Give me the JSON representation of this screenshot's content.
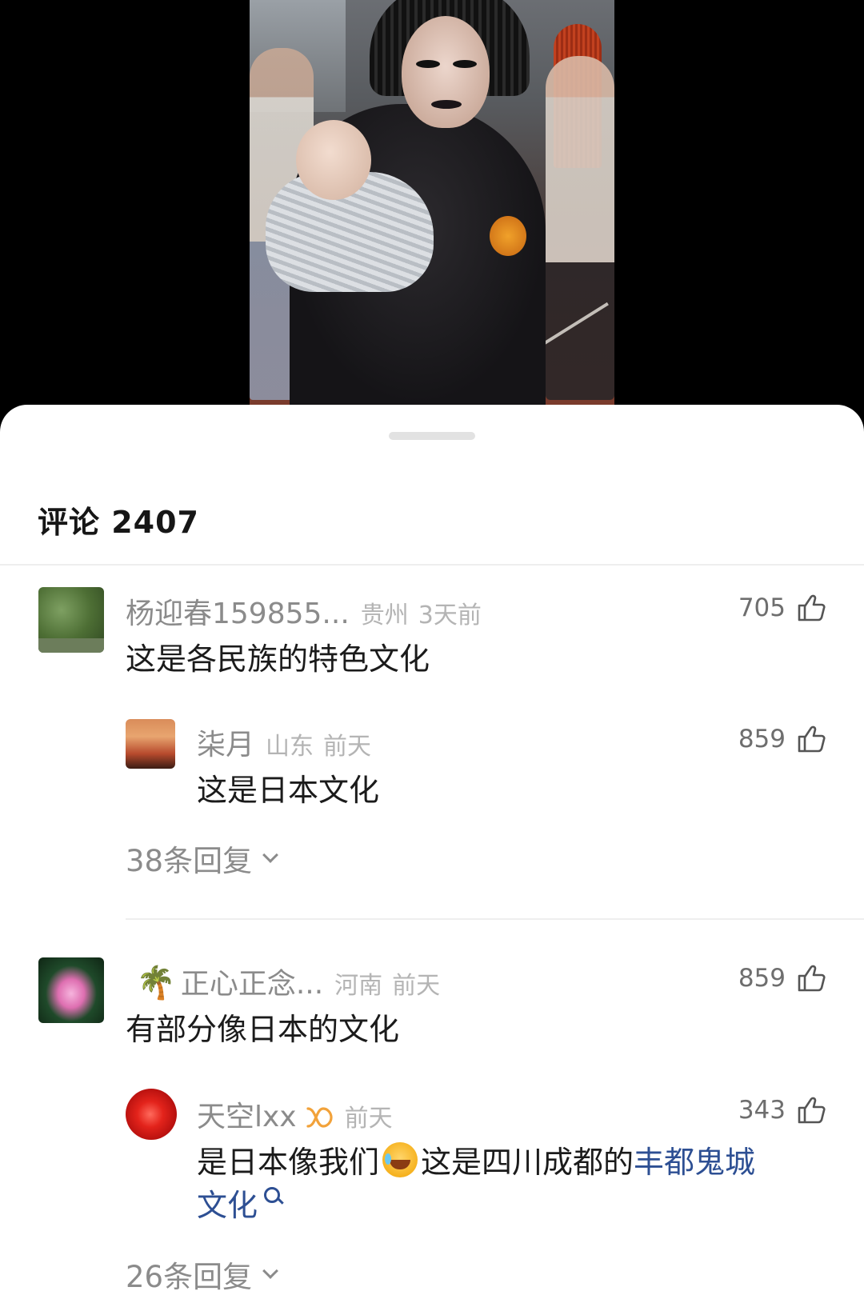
{
  "sheet": {
    "title": "评论 2407"
  },
  "comments": [
    {
      "username": "杨迎春159855...",
      "location": "贵州",
      "time": "3天前",
      "text": "这是各民族的特色文化",
      "likes": "705",
      "avatar_icon": "tree-avatar",
      "reply": {
        "username": "柒月",
        "location": "山东",
        "time": "前天",
        "text": "这是日本文化",
        "likes": "859",
        "avatar_icon": "girl-avatar"
      },
      "replies_label": "38条回复"
    },
    {
      "username": "正心正念...",
      "username_icon": "palm-tree-icon",
      "location": "河南",
      "time": "前天",
      "text": "有部分像日本的文化",
      "likes": "859",
      "avatar_icon": "lotus-avatar",
      "reply": {
        "username": "天空lxx",
        "badge_icon": "infinity-badge-icon",
        "time": "前天",
        "text_part1": "是日本像我们",
        "emoji_icon": "crying-laughing-emoji",
        "text_part2": "这是四川成都的",
        "link_text_1": "丰都鬼城",
        "link_text_2": "文化",
        "likes": "343",
        "avatar_icon": "rose-avatar"
      },
      "replies_label": "26条回复"
    }
  ],
  "colors": {
    "link": "#2d4f93",
    "username": "#8b8b8b",
    "meta": "#b4b4b4",
    "text": "#1b1b1b"
  }
}
